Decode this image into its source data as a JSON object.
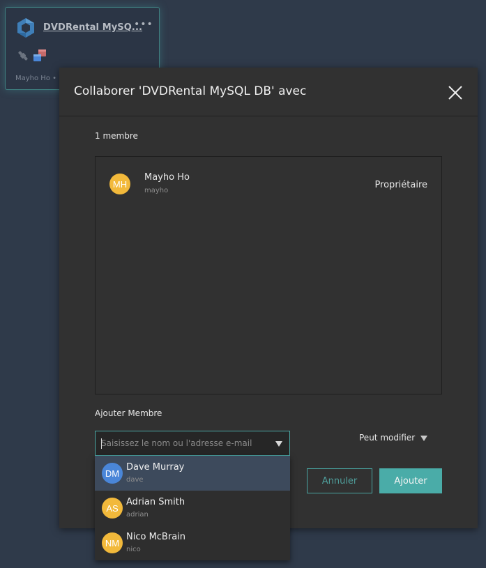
{
  "card": {
    "title": "DVDRental MySQ...",
    "more_icon": "more-horizontal-icon",
    "owner_text": "Mayho Ho •",
    "icons": [
      "hexagon-logo-icon",
      "plug-icon",
      "windows-icon"
    ]
  },
  "modal": {
    "title": "Collaborer 'DVDRental MySQL DB' avec",
    "close_icon": "close-icon",
    "member_count": "1 membre",
    "members": [
      {
        "initials": "MH",
        "name": "Mayho Ho",
        "username": "mayho",
        "role": "Propriétaire",
        "avatar_color": "#f2b93b"
      }
    ],
    "add_member_label": "Ajouter Membre",
    "search": {
      "placeholder": "Saisissez le nom ou l'adresse e-mail",
      "value": ""
    },
    "permission": {
      "selected": "Peut modifier"
    },
    "buttons": {
      "cancel": "Annuler",
      "add": "Ajouter"
    }
  },
  "suggestions": [
    {
      "initials": "DM",
      "name": "Dave Murray",
      "username": "dave",
      "avatar_color": "#4a86d8",
      "highlighted": true
    },
    {
      "initials": "AS",
      "name": "Adrian Smith",
      "username": "adrian",
      "avatar_color": "#f2b93b",
      "highlighted": false
    },
    {
      "initials": "NM",
      "name": "Nico McBrain",
      "username": "nico",
      "avatar_color": "#f2b93b",
      "highlighted": false
    }
  ],
  "colors": {
    "accent": "#4aaca8",
    "background": "#2f3a4a",
    "modal_bg": "#313131",
    "highlight": "#3d4a5c"
  }
}
